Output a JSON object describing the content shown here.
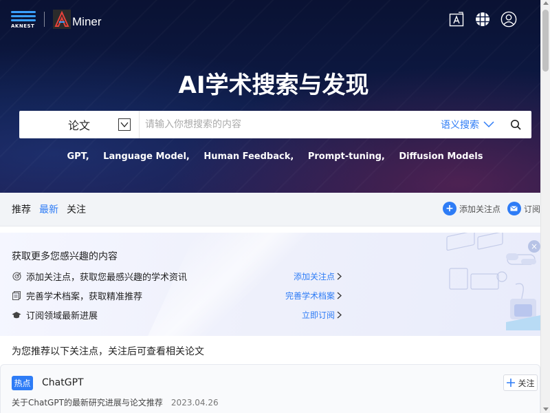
{
  "header": {
    "logo_cnest_text": "AKNEST",
    "logo_aminer_text": "Miner",
    "icons": [
      "translate-icon",
      "apps-grid-icon",
      "user-icon"
    ]
  },
  "hero": {
    "title": "AI学术搜索与发现",
    "search": {
      "type_label": "论文",
      "placeholder": "请输入你想搜索的内容",
      "mode_label": "语义搜索"
    },
    "hot_tags": [
      "GPT,",
      "Language Model,",
      "Human Feedback,",
      "Prompt-tuning,",
      "Diffusion Models"
    ]
  },
  "tabs": {
    "items": [
      "推荐",
      "最新",
      "关注"
    ],
    "active_index": 1,
    "actions": [
      {
        "label": "添加关注点",
        "icon": "plus-icon"
      },
      {
        "label": "订阅",
        "icon": "mail-icon"
      }
    ]
  },
  "banner": {
    "title": "获取更多您感兴趣的内容",
    "rows": [
      {
        "text": "添加关注点，获取您最感兴趣的学术资讯",
        "link": "添加关注点"
      },
      {
        "text": "完善学术档案，获取精准推荐",
        "link": "完善学术档案"
      },
      {
        "text": "订阅领域最新进展",
        "link": "立即订阅"
      }
    ],
    "close_label": "×"
  },
  "section": {
    "title": "为您推荐以下关注点，关注后可查看相关论文"
  },
  "card": {
    "badge": "热点",
    "title": "ChatGPT",
    "follow_label": "关注",
    "description": "关于ChatGPT的最新研究进展与论文推荐",
    "date": "2023.04.26"
  },
  "colors": {
    "accent": "#2e7cf6",
    "hero_bg": "#0d1a45"
  }
}
